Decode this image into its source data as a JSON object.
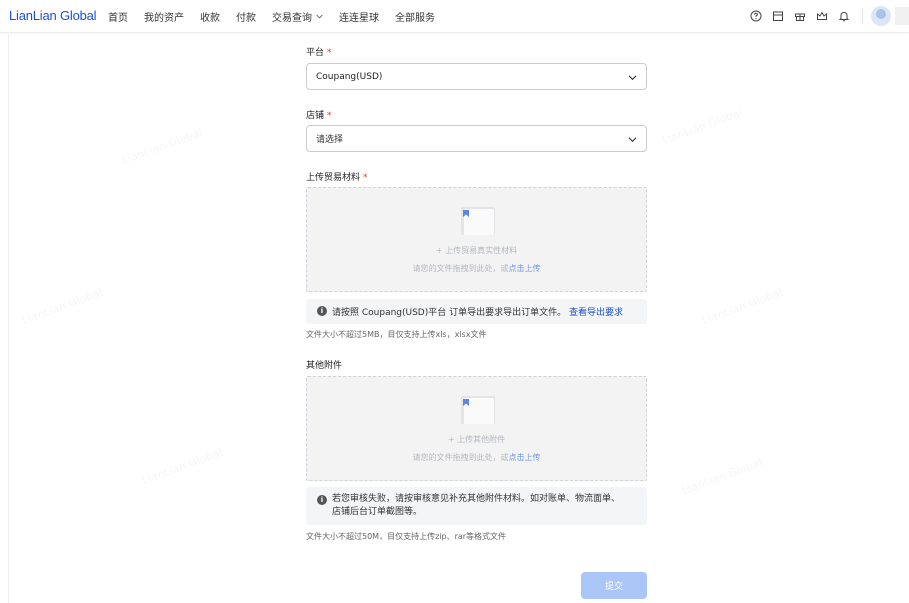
{
  "brand": {
    "name": "LianLian Global",
    "color": "#1a4fd6"
  },
  "nav": {
    "items": [
      "首页",
      "我的资产",
      "收款",
      "付款",
      "交易查询",
      "连连星球",
      "全部服务"
    ],
    "dropdown_item": "交易查询"
  },
  "header_icons": [
    "help-icon",
    "calendar-icon",
    "gift-icon",
    "crown-icon",
    "bell-icon",
    "avatar"
  ],
  "form": {
    "platform": {
      "label": "平台",
      "required": "*",
      "value": "Coupang(USD)"
    },
    "store": {
      "label": "店铺",
      "required": "*",
      "placeholder": "请选择"
    },
    "trade_material": {
      "label": "上传贸易材料",
      "required": "*",
      "title": "+ 上传贸易真实性材料",
      "hint_prefix": "请您的文件拖拽到此处，或",
      "hint_link": "点击上传",
      "notice_text": "请按照 Coupang(USD)平台 订单导出要求导出订单文件。",
      "notice_link": "查看导出要求",
      "tip": "文件大小不超过5MB，目仅支持上传xls，xlsx文件"
    },
    "other_attachment": {
      "label": "其他附件",
      "title": "+ 上传其他附件",
      "hint_prefix": "请您的文件拖拽到此处，或",
      "hint_link": "点击上传",
      "notice_line1": "若您审核失败，请按审核意见补充其他附件材料。如对账单、物流面单、",
      "notice_line2": "店铺后台订单截图等。",
      "tip": "文件大小不超过50M，目仅支持上传zip、rar等格式文件"
    },
    "submit_label": "提交"
  },
  "colors": {
    "accent": "#1a4fd6",
    "required": "#e0392b",
    "submit_disabled": "#a9c6f7"
  }
}
